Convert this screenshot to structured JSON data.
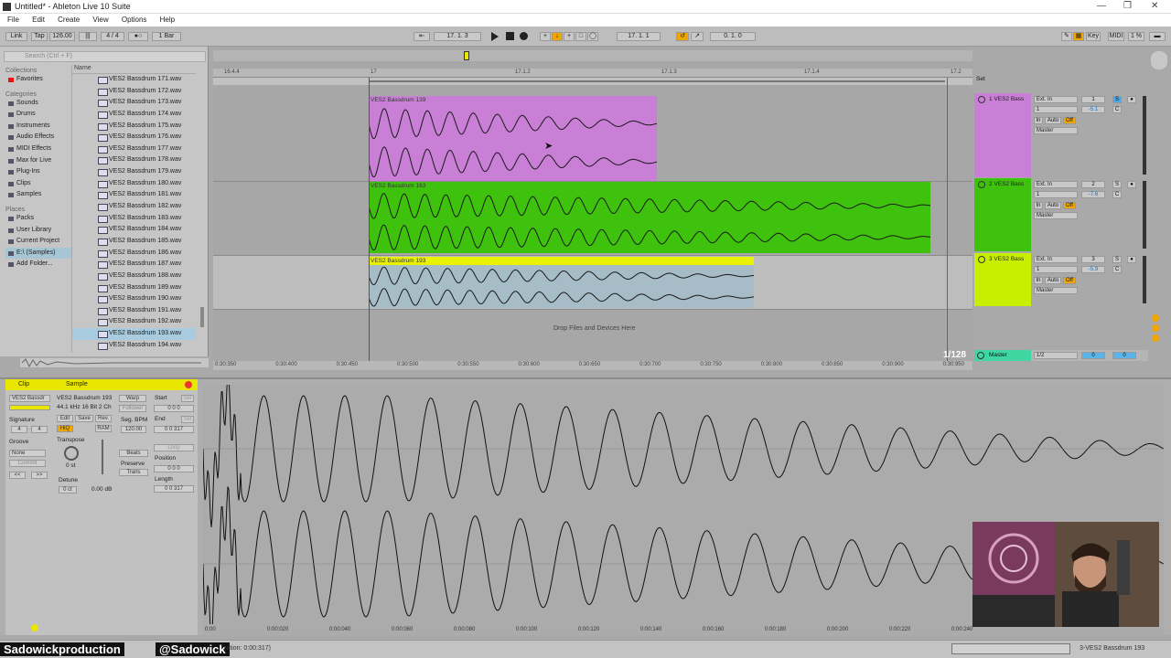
{
  "window": {
    "title": "Untitled* - Ableton Live 10 Suite"
  },
  "menu": [
    "File",
    "Edit",
    "Create",
    "View",
    "Options",
    "Help"
  ],
  "control_bar": {
    "link": "Link",
    "tap": "Tap",
    "tempo": "126.00",
    "signature": "4 / 4",
    "quantize": "1 Bar",
    "position": "17. 1. 3",
    "loop_start": "17. 1. 1",
    "loop_length": "0. 1. 0",
    "key": "Key",
    "midi": "MIDI",
    "cpu": "1 %"
  },
  "browser": {
    "search_placeholder": "Search (Ctrl + F)",
    "collections_header": "Collections",
    "favorites": "Favorites",
    "categories_header": "Categories",
    "categories": [
      "Sounds",
      "Drums",
      "Instruments",
      "Audio Effects",
      "MIDI Effects",
      "Max for Live",
      "Plug-Ins",
      "Clips",
      "Samples"
    ],
    "places_header": "Places",
    "places": [
      "Packs",
      "User Library",
      "Current Project",
      "E:\\ (Samples)",
      "Add Folder..."
    ],
    "name_header": "Name",
    "files": [
      "VES2 Bassdrum 171.wav",
      "VES2 Bassdrum 172.wav",
      "VES2 Bassdrum 173.wav",
      "VES2 Bassdrum 174.wav",
      "VES2 Bassdrum 175.wav",
      "VES2 Bassdrum 176.wav",
      "VES2 Bassdrum 177.wav",
      "VES2 Bassdrum 178.wav",
      "VES2 Bassdrum 179.wav",
      "VES2 Bassdrum 180.wav",
      "VES2 Bassdrum 181.wav",
      "VES2 Bassdrum 182.wav",
      "VES2 Bassdrum 183.wav",
      "VES2 Bassdrum 184.wav",
      "VES2 Bassdrum 185.wav",
      "VES2 Bassdrum 186.wav",
      "VES2 Bassdrum 187.wav",
      "VES2 Bassdrum 188.wav",
      "VES2 Bassdrum 189.wav",
      "VES2 Bassdrum 190.wav",
      "VES2 Bassdrum 191.wav",
      "VES2 Bassdrum 192.wav",
      "VES2 Bassdrum 193.wav",
      "VES2 Bassdrum 194.wav"
    ],
    "selected_file": "VES2 Bassdrum 193.wav"
  },
  "arrangement": {
    "ruler": [
      "16.4.4",
      "17",
      "17.1.2",
      "17.1.3",
      "17.1.4",
      "17.2"
    ],
    "clips": [
      {
        "name": "VES2 Bassdrum 139",
        "color": "#c97fd6"
      },
      {
        "name": "VES2 Bassdrum 163",
        "color": "#3fc20d"
      },
      {
        "name": "VES2 Bassdrum 193",
        "color": "#e9f200"
      }
    ],
    "drop_text": "Drop Files and Devices Here",
    "zoom": "1/128",
    "time_ticks": [
      "0:30:350",
      "0:30:400",
      "0:30:450",
      "0:30:500",
      "0:30:550",
      "0:30:600",
      "0:30:650",
      "0:30:700",
      "0:30:750",
      "0:30:800",
      "0:30:850",
      "0:30:900",
      "0:30:950"
    ]
  },
  "mixer": {
    "set_label": "Set",
    "tracks": [
      {
        "name": "1 VES2 Bass",
        "input": "Ext. In",
        "channel": "1",
        "volume": "-5.1",
        "color": "#c97fd6",
        "number": "1"
      },
      {
        "name": "2 VES2 Bass",
        "input": "Ext. In",
        "channel": "1",
        "volume": "-7.6",
        "color": "#3fc20d",
        "number": "2"
      },
      {
        "name": "3 VES2 Bass",
        "input": "Ext. In",
        "channel": "1",
        "volume": "-5.9",
        "color": "#c8ef00",
        "number": "3"
      }
    ],
    "monitor": {
      "in": "In",
      "auto": "Auto",
      "off": "Off"
    },
    "out": "Master",
    "master": {
      "name": "Master",
      "channel": "1/2",
      "vol": "0",
      "pan": "0"
    }
  },
  "detail": {
    "clip_tab": "Clip",
    "sample_tab": "Sample",
    "clip_name": "VES2 Bassdr",
    "signature_label": "Signature",
    "sig_num": "4",
    "sig_den": "4",
    "groove_label": "Groove",
    "groove_value": "None",
    "commit": "Commit",
    "sample_name": "VES2 Bassdrum 193",
    "sample_info": "44.1 kHz 16 Bit 2 Ch",
    "edit": "Edit",
    "save": "Save",
    "rev": "Rev.",
    "hiq": "HiQ",
    "ram": "RAM",
    "warp": "Warp",
    "follower": "Follower",
    "seg_bpm_label": "Seg. BPM",
    "seg_bpm": "120.00",
    "transpose_label": "Transpose",
    "transpose_value": "0 st",
    "detune_label": "Detune",
    "detune_value": "0 ct",
    "gain": "0.00 dB",
    "beats": "Beats",
    "preserve_label": "Preserve",
    "trans": "Trans",
    "start_label": "Start",
    "end_label": "End",
    "loop_label": "Loop",
    "position_label": "Position",
    "length_label": "Length",
    "start_value": "0  0  0",
    "end_value": "0  0  317",
    "position_value": "0  0  0",
    "length_value": "0  0  317",
    "set": "Set",
    "time_ticks": [
      "0:00",
      "0:00:020",
      "0:00:040",
      "0:00:060",
      "0:00:080",
      "0:00:100",
      "0:00:120",
      "0:00:140",
      "0:00:160",
      "0:00:180",
      "0:00:200",
      "0:00:220",
      "0:00:240"
    ]
  },
  "status": {
    "youtube": "Sadowickproduction",
    "twitter": "@Sadowick",
    "duration": "ration: 0:00:317)",
    "track": "3-VES2 Bassdrum 193"
  }
}
